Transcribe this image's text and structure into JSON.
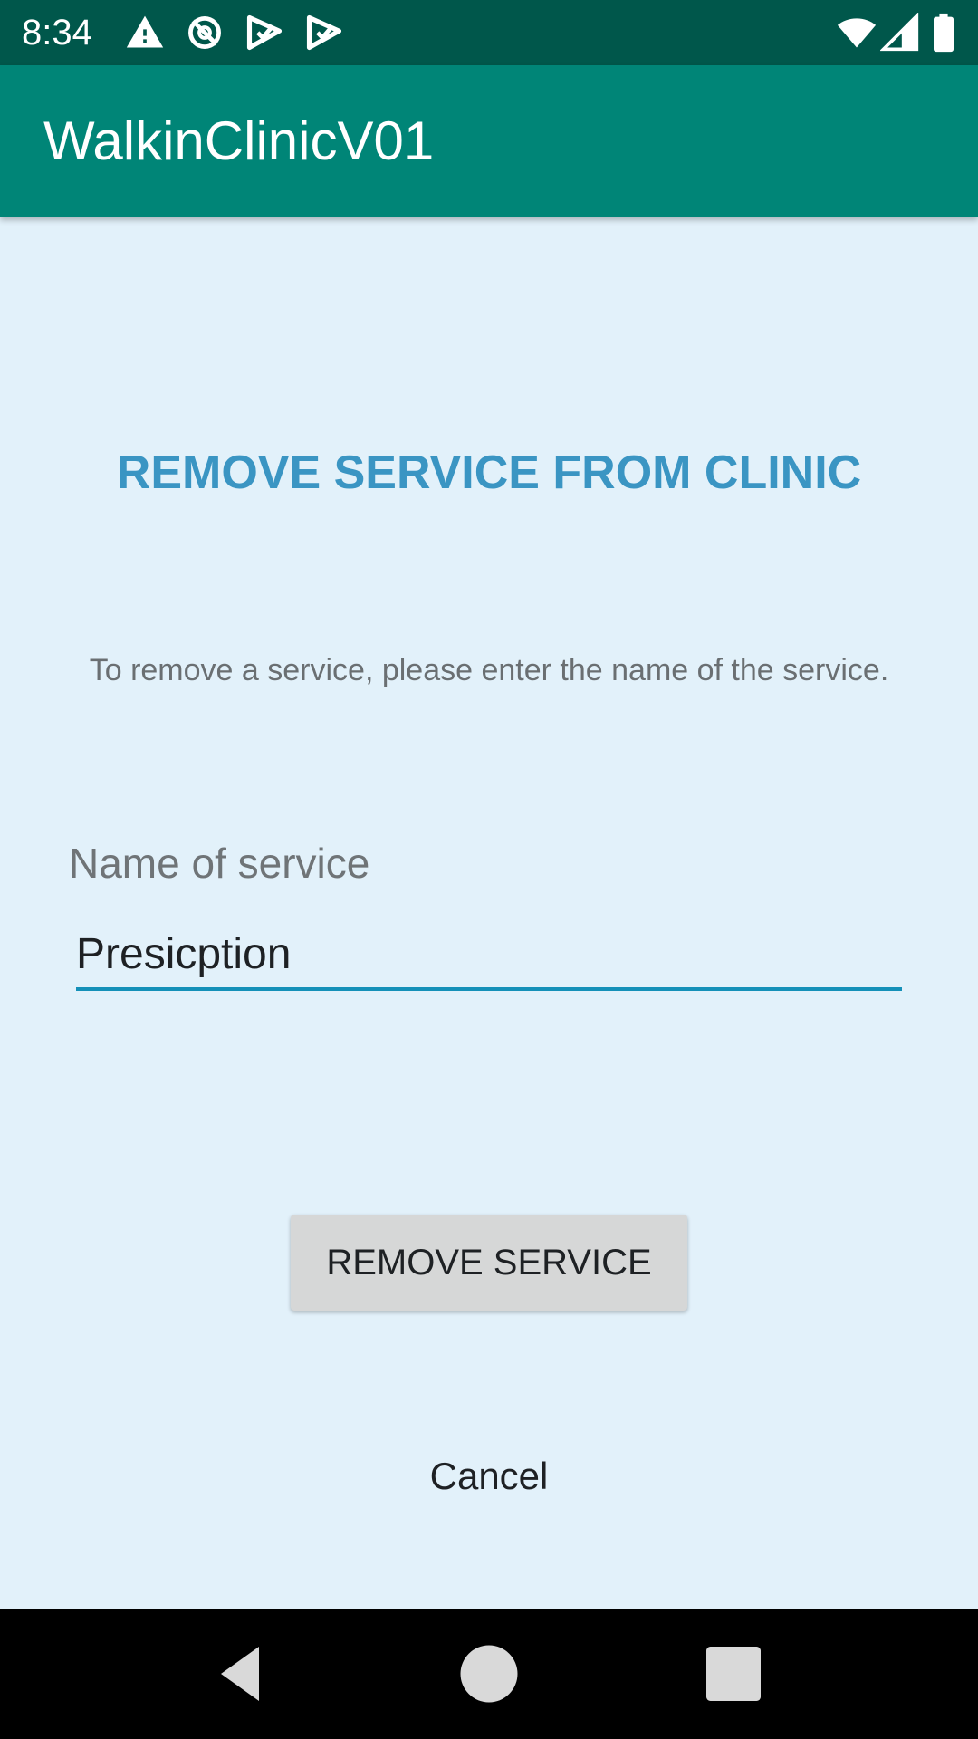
{
  "status_bar": {
    "time": "8:34",
    "icons": [
      "warning-icon",
      "sync-disabled-icon",
      "play-store-icon",
      "play-store-icon",
      "wifi-icon",
      "cellular-signal-icon",
      "battery-icon"
    ]
  },
  "app_bar": {
    "title": "WalkinClinicV01"
  },
  "main": {
    "heading": "REMOVE SERVICE FROM CLINIC",
    "instruction": "To remove a service, please enter the name of the service.",
    "field_label": "Name of service",
    "service_name_value": "Presicption",
    "remove_button_label": "REMOVE SERVICE",
    "cancel_label": "Cancel"
  },
  "nav_bar": {
    "buttons": [
      "back-icon",
      "home-icon",
      "recents-icon"
    ]
  },
  "colors": {
    "status_bar": "#00574B",
    "app_bar": "#008577",
    "background": "#E2F1FA",
    "heading": "#3A95C3",
    "input_underline": "#1490B8",
    "button": "#D6D7D7"
  }
}
